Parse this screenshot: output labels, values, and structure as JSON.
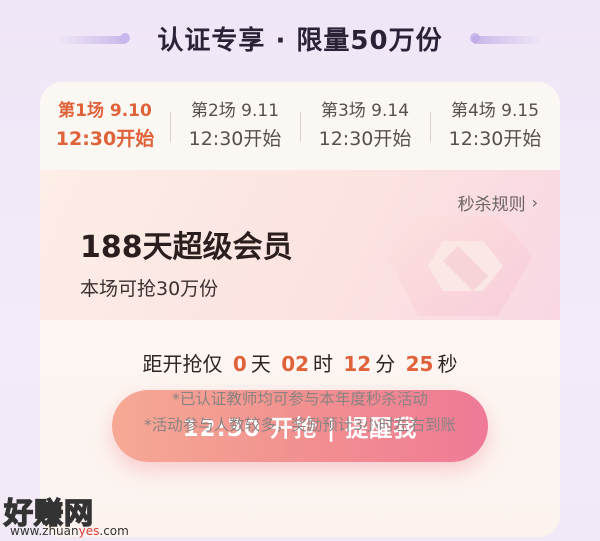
{
  "headline": "认证专享 · 限量50万份",
  "sessions": [
    {
      "date": "第1场 9.10",
      "time": "12:30开始",
      "active": true
    },
    {
      "date": "第2场 9.11",
      "time": "12:30开始",
      "active": false
    },
    {
      "date": "第3场 9.14",
      "time": "12:30开始",
      "active": false
    },
    {
      "date": "第4场 9.15",
      "time": "12:30开始",
      "active": false
    }
  ],
  "promo": {
    "rules_label": "秒杀规则",
    "title": "188天超级会员",
    "subtitle": "本场可抢30万份"
  },
  "countdown": {
    "prefix": "距开抢仅",
    "days": "0",
    "days_unit": "天",
    "hours": "02",
    "hours_unit": "时",
    "minutes": "12",
    "minutes_unit": "分",
    "seconds": "25",
    "seconds_unit": "秒"
  },
  "cta": {
    "label": "12:30 开抢 | 提醒我"
  },
  "notes": [
    "*已认证教师均可参与本年度秒杀活动",
    "*活动参与人数较多，奖励预计3小时左右到账"
  ],
  "watermark": {
    "text": "好赚网",
    "url_prefix": "www.zhuan",
    "url_accent": "yes",
    "url_suffix": ".com"
  },
  "colors": {
    "accent": "#e0623a",
    "cta_start": "#f6a995",
    "cta_end": "#ef7a96"
  }
}
